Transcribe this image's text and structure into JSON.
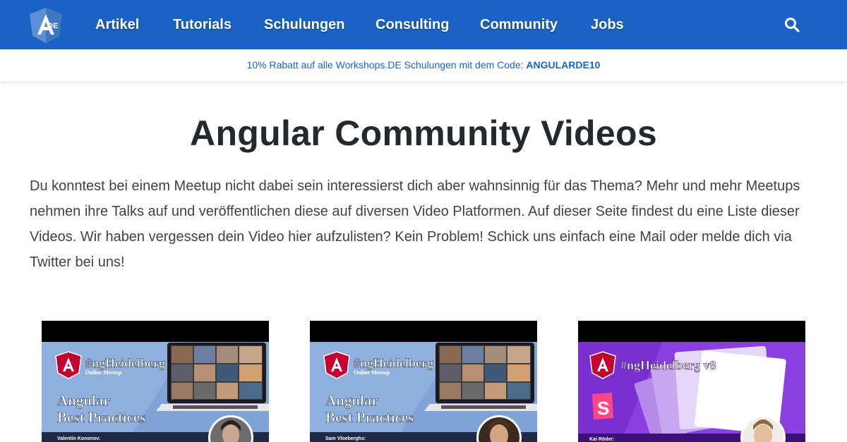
{
  "nav": {
    "logo_text": "DE",
    "items": [
      "Artikel",
      "Tutorials",
      "Schulungen",
      "Consulting",
      "Community",
      "Jobs"
    ]
  },
  "promo": {
    "text": "10% Rabatt auf alle Workshops.DE Schulungen mit dem Code:",
    "code": "ANGULARDE10"
  },
  "main": {
    "title": "Angular Community Videos",
    "intro": "Du konntest bei einem Meetup nicht dabei sein interessierst dich aber wahnsinnig für das Thema? Mehr und mehr Meetups nehmen ihre Talks auf und veröffentlichen diese auf diversen Video Platformen. Auf dieser Seite findest du eine Liste dieser Videos. Wir haben vergessen dein Video hier aufzulisten? Kein Problem! Schick uns einfach eine Mail oder melde dich via Twitter bei uns!"
  },
  "videos": [
    {
      "event": "#ngHeidelberg v11",
      "subtitle": "Online Meetup",
      "topic_line1": "Angular",
      "topic_line2": "Best Practices",
      "speaker": "Valentin Kononov:"
    },
    {
      "event": "#ngHeidelberg v11",
      "subtitle": "Online Meetup",
      "topic_line1": "Angular",
      "topic_line2": "Best Practices",
      "speaker": "Sam Vloeberghs:"
    },
    {
      "event": "#ngHeidelberg v8",
      "speaker": "Kai Röder:"
    }
  ],
  "colors": {
    "nav_bg": "#1a63c4",
    "accent": "#1a63c4",
    "thumb_blue": "#7fa3d6",
    "thumb_purple": "#7b2fd0",
    "angular_red": "#c3002f"
  }
}
